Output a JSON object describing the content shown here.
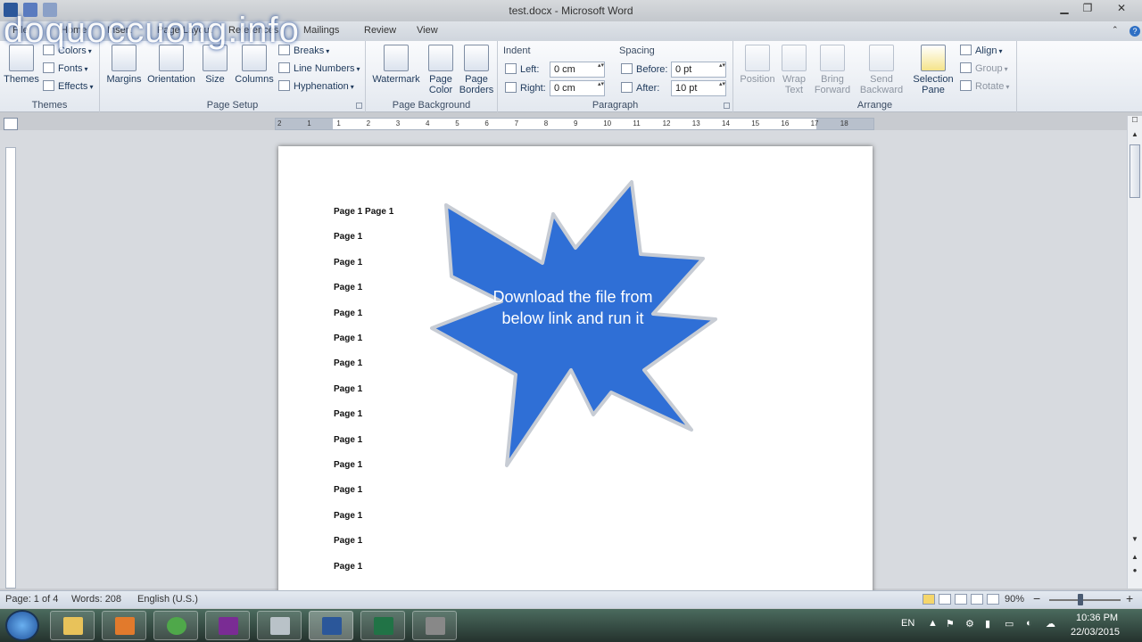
{
  "window": {
    "title": "test.docx - Microsoft Word",
    "minimize": "▁",
    "restore": "❐",
    "close": "✕",
    "ribbon_min": "⌃",
    "help": "?"
  },
  "watermark": "doquoccuong.info",
  "tabs": [
    "File",
    "Home",
    "Insert",
    "Page Layout",
    "References",
    "Mailings",
    "Review",
    "View"
  ],
  "ribbon": {
    "themes": {
      "label": "Themes",
      "themes_btn": "Themes",
      "colors": "Colors",
      "fonts": "Fonts",
      "effects": "Effects"
    },
    "page_setup": {
      "label": "Page Setup",
      "margins": "Margins",
      "orientation": "Orientation",
      "size": "Size",
      "columns": "Columns",
      "breaks": "Breaks",
      "line_numbers": "Line Numbers",
      "hyphenation": "Hyphenation"
    },
    "page_background": {
      "label": "Page Background",
      "watermark": "Watermark",
      "page_color_1": "Page",
      "page_color_2": "Color",
      "page_borders_1": "Page",
      "page_borders_2": "Borders"
    },
    "paragraph": {
      "label": "Paragraph",
      "indent": "Indent",
      "left": "Left:",
      "left_value": "0 cm",
      "right": "Right:",
      "right_value": "0 cm",
      "spacing": "Spacing",
      "before": "Before:",
      "before_value": "0 pt",
      "after": "After:",
      "after_value": "10 pt"
    },
    "arrange": {
      "label": "Arrange",
      "position": "Position",
      "wrap_1": "Wrap",
      "wrap_2": "Text",
      "bring_1": "Bring",
      "bring_2": "Forward",
      "send_1": "Send",
      "send_2": "Backward",
      "sel_1": "Selection",
      "sel_2": "Pane",
      "align": "Align",
      "group": "Group",
      "rotate": "Rotate"
    }
  },
  "ruler_ticks": [
    "2",
    "1",
    "1",
    "2",
    "3",
    "4",
    "5",
    "6",
    "7",
    "8",
    "9",
    "10",
    "11",
    "12",
    "13",
    "14",
    "15",
    "16",
    "17",
    "18"
  ],
  "document": {
    "lines": [
      "Page 1 Page 1",
      "Page 1",
      "Page 1",
      "Page 1",
      "Page 1",
      "Page 1",
      "Page 1",
      "Page 1",
      "Page 1",
      "Page 1",
      "Page 1",
      "Page 1",
      "Page 1",
      "Page 1",
      "Page 1"
    ],
    "shape_text": "Download the file from below link and run it",
    "shape_color": "#2f6fd6"
  },
  "status": {
    "page": "Page: 1 of 4",
    "words": "Words: 208",
    "language": "English (U.S.)",
    "zoom": "90%",
    "zoom_out": "−",
    "zoom_in": "+"
  },
  "taskbar": {
    "lang": "EN",
    "time": "10:36 PM",
    "date": "22/03/2015",
    "icons": [
      "explorer-icon",
      "media-player-icon",
      "app-green-icon",
      "yahoo-messenger-icon",
      "app-silver-icon",
      "word-icon",
      "excel-icon",
      "app-recorder-icon"
    ]
  }
}
